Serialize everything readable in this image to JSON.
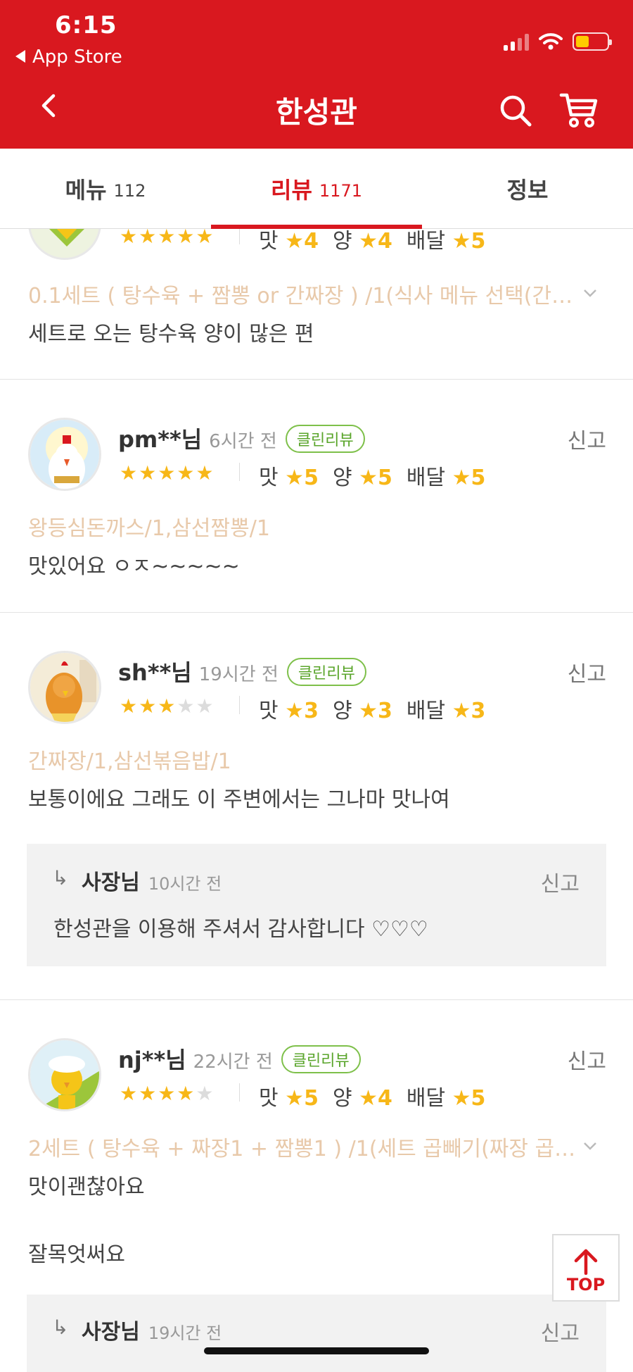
{
  "status_bar": {
    "time": "6:15",
    "back_app": "App Store"
  },
  "header": {
    "title": "한성관"
  },
  "tabs": [
    {
      "label": "메뉴",
      "count": "112",
      "active": false
    },
    {
      "label": "리뷰",
      "count": "1171",
      "active": true
    },
    {
      "label": "정보",
      "count": "",
      "active": false
    }
  ],
  "reviews": [
    {
      "rating": 5,
      "scores": {
        "taste_label": "맛",
        "taste": "4",
        "amount_label": "양",
        "amount": "4",
        "delivery_label": "배달",
        "delivery": "5"
      },
      "order": "0.1세트 ( 탕수육 + 짬뽕 or 간짜장 ) /1(식사 메뉴 선택(간…",
      "text": "세트로 오는 탕수육 양이 많은 편"
    },
    {
      "user": "pm**님",
      "time": "6시간 전",
      "badge": "클린리뷰",
      "report": "신고",
      "rating": 5,
      "scores": {
        "taste_label": "맛",
        "taste": "5",
        "amount_label": "양",
        "amount": "5",
        "delivery_label": "배달",
        "delivery": "5"
      },
      "order": "왕등심돈까스/1,삼선짬뽕/1",
      "text": "맛있어요 ㅇㅈ~~~~~"
    },
    {
      "user": "sh**님",
      "time": "19시간 전",
      "badge": "클린리뷰",
      "report": "신고",
      "rating": 3,
      "scores": {
        "taste_label": "맛",
        "taste": "3",
        "amount_label": "양",
        "amount": "3",
        "delivery_label": "배달",
        "delivery": "3"
      },
      "order": "간짜장/1,삼선볶음밥/1",
      "text": "보통이에요 그래도 이 주변에서는 그나마 맛나여",
      "owner_reply": {
        "arrow": "↳",
        "name": "사장님",
        "time": "10시간 전",
        "report": "신고",
        "text": "한성관을 이용해 주셔서 감사합니다 ♡♡♡"
      }
    },
    {
      "user": "nj**님",
      "time": "22시간 전",
      "badge": "클린리뷰",
      "report": "신고",
      "rating": 4,
      "scores": {
        "taste_label": "맛",
        "taste": "5",
        "amount_label": "양",
        "amount": "4",
        "delivery_label": "배달",
        "delivery": "5"
      },
      "order": "2세트 ( 탕수육 + 짜장1 + 짬뽕1 ) /1(세트 곱빼기(짜장 곱…",
      "text": "맛이괜찮아요",
      "text2": "잘목엇써요",
      "owner_reply": {
        "arrow": "↳",
        "name": "사장님",
        "time": "19시간 전",
        "report": "신고"
      }
    }
  ],
  "top_button": {
    "label": "TOP"
  },
  "colors": {
    "brand_red": "#d9181f",
    "star": "#f7b718",
    "order_text": "#e8c9aa",
    "clean_badge": "#5aa52b"
  }
}
